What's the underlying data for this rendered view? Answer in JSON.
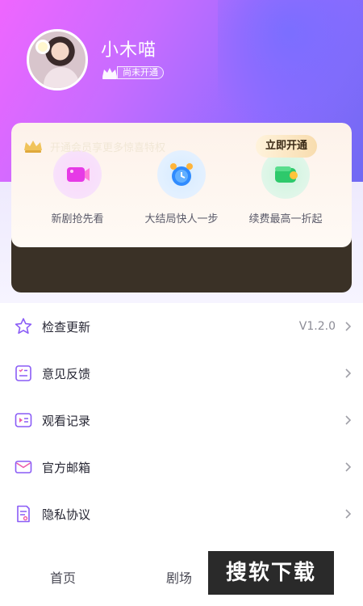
{
  "profile": {
    "username": "小木喵",
    "vip_status": "尚未开通"
  },
  "vip_card": {
    "benefits": [
      {
        "label": "新剧抢先看",
        "icon": "video-camera-icon"
      },
      {
        "label": "大结局快人一步",
        "icon": "alarm-clock-icon"
      },
      {
        "label": "续费最高一折起",
        "icon": "wallet-coin-icon"
      }
    ],
    "promo_text": "开通会员享更多惊喜特权",
    "open_button": "立即开通"
  },
  "menu": [
    {
      "label": "检查更新",
      "value": "V1.2.0",
      "icon": "star-icon"
    },
    {
      "label": "意见反馈",
      "value": "",
      "icon": "feedback-list-icon"
    },
    {
      "label": "观看记录",
      "value": "",
      "icon": "play-history-icon"
    },
    {
      "label": "官方邮箱",
      "value": "",
      "icon": "mail-icon"
    },
    {
      "label": "隐私协议",
      "value": "",
      "icon": "document-icon"
    }
  ],
  "tabs": {
    "home": "首页",
    "theater": "剧场"
  },
  "watermark": "搜软下载",
  "colors": {
    "accent": "#8a5cf6",
    "vip_bar": "#3a3126",
    "gold": "#f0c35a"
  }
}
